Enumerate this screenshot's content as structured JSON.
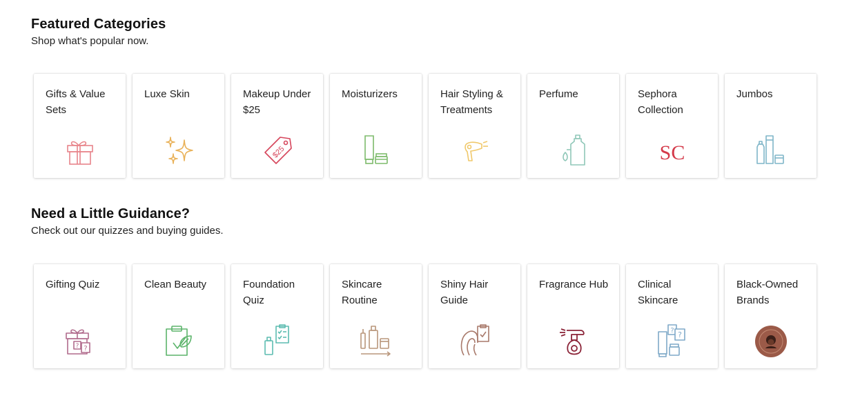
{
  "featured": {
    "title": "Featured Categories",
    "subtitle": "Shop what's popular now.",
    "tiles": [
      {
        "label": "Gifts & Value Sets",
        "icon": "gift-box-icon",
        "color": "#e8848a"
      },
      {
        "label": "Luxe Skin",
        "icon": "sparkles-icon",
        "color": "#e9b25a"
      },
      {
        "label": "Makeup Under $25",
        "icon": "price-tag-icon",
        "color": "#d6455b",
        "tag_text": "$25"
      },
      {
        "label": "Moisturizers",
        "icon": "moisturizer-tube-icon",
        "color": "#7dbb6b"
      },
      {
        "label": "Hair Styling & Treatments",
        "icon": "hair-dryer-icon",
        "color": "#f0c86a"
      },
      {
        "label": "Perfume",
        "icon": "perfume-bottle-icon",
        "color": "#8fc7b8"
      },
      {
        "label": "Sephora Collection",
        "icon": "sc-logo-icon",
        "color": "#d43a4a",
        "logo_text": "SC"
      },
      {
        "label": "Jumbos",
        "icon": "jumbo-bottles-icon",
        "color": "#7fb5c8"
      }
    ]
  },
  "guidance": {
    "title": "Need a Little Guidance?",
    "subtitle": "Check out our quizzes and buying guides.",
    "tiles": [
      {
        "label": "Gifting Quiz",
        "icon": "gift-quiz-icon",
        "color": "#b06a8c"
      },
      {
        "label": "Clean Beauty",
        "icon": "clipboard-leaf-icon",
        "color": "#5bb46a"
      },
      {
        "label": "Foundation Quiz",
        "icon": "foundation-checklist-icon",
        "color": "#5cbcb0"
      },
      {
        "label": "Skincare Routine",
        "icon": "skincare-routine-icon",
        "color": "#b8957a"
      },
      {
        "label": "Shiny Hair Guide",
        "icon": "hair-guide-icon",
        "color": "#a8796a"
      },
      {
        "label": "Fragrance Hub",
        "icon": "fragrance-atomizer-icon",
        "color": "#8b2438"
      },
      {
        "label": "Clinical Skincare",
        "icon": "clinical-skincare-icon",
        "color": "#7fa9c8"
      },
      {
        "label": "Black-Owned Brands",
        "icon": "black-owned-badge-icon",
        "color": "#9b5a48"
      }
    ]
  }
}
